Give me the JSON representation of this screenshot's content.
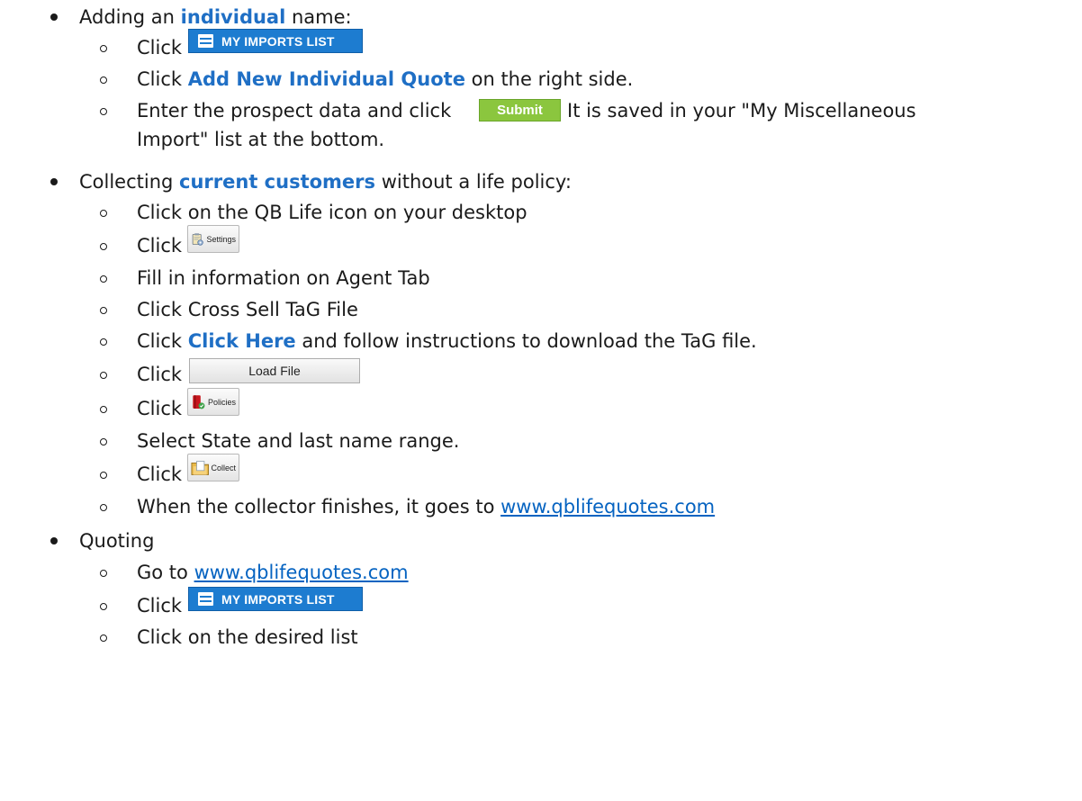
{
  "section1": {
    "prefix": "Adding an ",
    "highlight": "individual",
    "suffix": " name:",
    "steps": {
      "click1": "Click",
      "imports_button": "MY IMPORTS LIST",
      "click2_prefix": "Click ",
      "click2_highlight": "Add New Individual Quote",
      "click2_suffix": " on the right side.",
      "enter_prefix": "Enter the prospect data and click",
      "submit_button": "Submit",
      "enter_suffix": "It is saved in your \"My Miscellaneous",
      "enter_cont": "Import\" list at the bottom."
    }
  },
  "section2": {
    "prefix": "Collecting ",
    "highlight": "current customers",
    "suffix": " without a life policy:",
    "steps": {
      "s1": "Click on the QB Life icon on your desktop",
      "s2": "Click",
      "settings_button": "Settings",
      "s3": "Fill in information on Agent Tab",
      "s4": "Click Cross Sell TaG File",
      "s5_prefix": "Click ",
      "s5_highlight": "Click Here",
      "s5_suffix": " and follow instructions to download the TaG file.",
      "s6": "Click",
      "load_button": "Load File",
      "s7": "Click",
      "policies_button": "Policies",
      "s8": "Select State and last name range.",
      "s9": "Click",
      "collect_button": "Collect",
      "s10_prefix": "When the collector finishes, it goes to ",
      "s10_link": "www.qblifequotes.com"
    }
  },
  "section3": {
    "title": "Quoting",
    "steps": {
      "s1_prefix": "Go to ",
      "s1_link": "www.qblifequotes.com",
      "s2": "Click",
      "imports_button": "MY IMPORTS LIST",
      "s3": "Click on the desired list"
    }
  },
  "colors": {
    "highlight": "#1f6fc5",
    "link": "#0563c1",
    "imports_button": "#1d7cd0",
    "submit_button": "#8bc63e"
  }
}
